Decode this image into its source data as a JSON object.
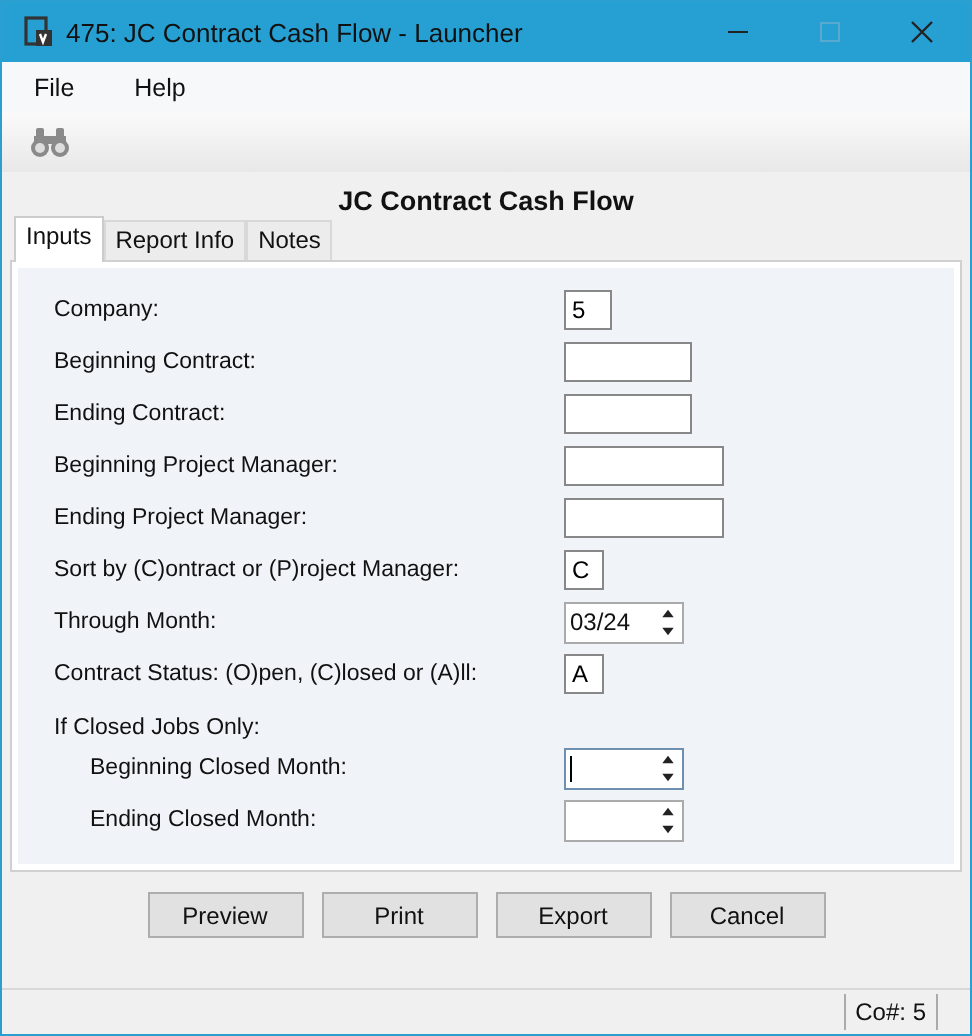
{
  "window": {
    "title": "475: JC Contract Cash Flow - Launcher"
  },
  "menu": [
    "File",
    "Help"
  ],
  "heading": "JC Contract Cash Flow",
  "tabs": [
    {
      "label": "Inputs",
      "selected": true
    },
    {
      "label": "Report Info",
      "selected": false
    },
    {
      "label": "Notes",
      "selected": false
    }
  ],
  "fields": [
    {
      "kind": "company",
      "label": "Company:",
      "value": "5"
    },
    {
      "kind": "code",
      "label": "Beginning Contract:"
    },
    {
      "kind": "code",
      "label": "Ending Contract:"
    },
    {
      "kind": "name",
      "label": "Beginning Project Manager:"
    },
    {
      "kind": "name",
      "label": "Ending Project Manager:"
    },
    {
      "kind": "char",
      "label": "Sort by (C)ontract or (P)roject Manager:",
      "value": "C"
    },
    {
      "kind": "month",
      "label": "Through Month:",
      "value": "03/24"
    },
    {
      "kind": "char",
      "label": "Contract Status:  (O)pen, (C)losed or (A)ll:",
      "value": "A"
    }
  ],
  "closed_section": {
    "label": "If Closed Jobs Only:",
    "fields": [
      {
        "kind": "month",
        "label": "Beginning Closed Month:",
        "focused": true
      },
      {
        "kind": "month",
        "label": "Ending Closed Month:",
        "focused": false
      }
    ]
  },
  "buttons": [
    "Preview",
    "Print",
    "Export",
    "Cancel"
  ],
  "status_bar": {
    "company": "Co#: 5"
  }
}
